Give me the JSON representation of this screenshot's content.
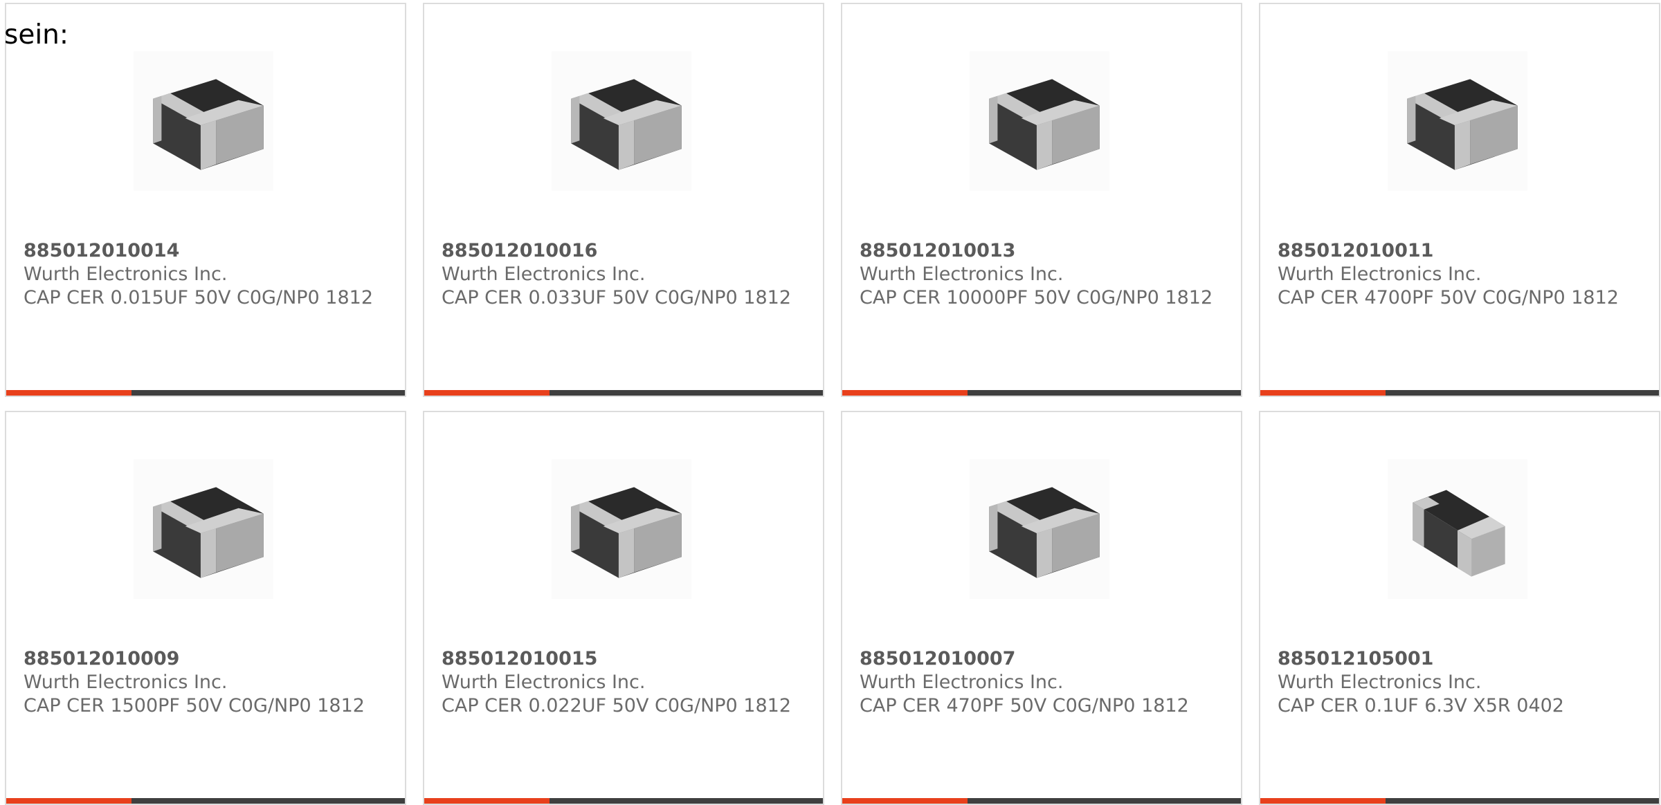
{
  "heading": "sein:",
  "colors": {
    "accent_bar": "#e8401c",
    "dark_bar": "#3f3f3f",
    "card_border": "#dcdcdc",
    "text": "#6a6a6a"
  },
  "products": [
    {
      "part_number": "885012010014",
      "manufacturer": "Wurth Electronics Inc.",
      "description": "CAP CER 0.015UF 50V C0G/NP0 1812",
      "image_icon": "smd-capacitor-1812-icon"
    },
    {
      "part_number": "885012010016",
      "manufacturer": "Wurth Electronics Inc.",
      "description": "CAP CER 0.033UF 50V C0G/NP0 1812",
      "image_icon": "smd-capacitor-1812-icon"
    },
    {
      "part_number": "885012010013",
      "manufacturer": "Wurth Electronics Inc.",
      "description": "CAP CER 10000PF 50V C0G/NP0 1812",
      "image_icon": "smd-capacitor-1812-icon"
    },
    {
      "part_number": "885012010011",
      "manufacturer": "Wurth Electronics Inc.",
      "description": "CAP CER 4700PF 50V C0G/NP0 1812",
      "image_icon": "smd-capacitor-1812-icon"
    },
    {
      "part_number": "885012010009",
      "manufacturer": "Wurth Electronics Inc.",
      "description": "CAP CER 1500PF 50V C0G/NP0 1812",
      "image_icon": "smd-capacitor-1812-icon"
    },
    {
      "part_number": "885012010015",
      "manufacturer": "Wurth Electronics Inc.",
      "description": "CAP CER 0.022UF 50V C0G/NP0 1812",
      "image_icon": "smd-capacitor-1812-icon"
    },
    {
      "part_number": "885012010007",
      "manufacturer": "Wurth Electronics Inc.",
      "description": "CAP CER 470PF 50V C0G/NP0 1812",
      "image_icon": "smd-capacitor-1812-icon"
    },
    {
      "part_number": "885012105001",
      "manufacturer": "Wurth Electronics Inc.",
      "description": "CAP CER 0.1UF 6.3V X5R 0402",
      "image_icon": "smd-capacitor-0402-icon"
    }
  ]
}
